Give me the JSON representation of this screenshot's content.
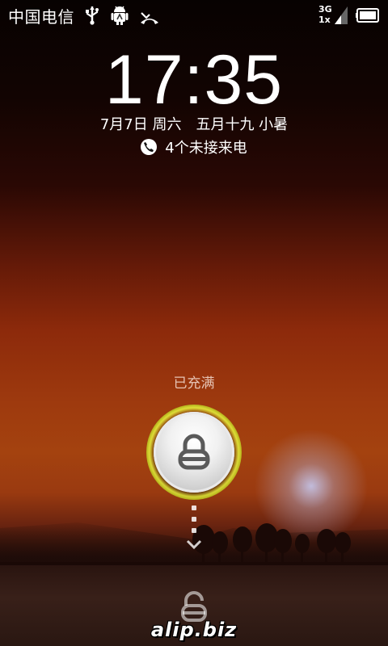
{
  "status_bar": {
    "carrier": "中国电信",
    "icons_left": [
      "usb-icon",
      "android-debug-icon",
      "missed-call-icon"
    ],
    "network_top": "3G",
    "network_bottom": "1x",
    "icons_right": [
      "signal-icon",
      "battery-full-icon"
    ]
  },
  "lockscreen": {
    "time": "17:35",
    "date": "7月7日 周六　五月十九 小暑",
    "missed_calls": "4个未接来电",
    "charge_status": "已充满"
  },
  "watermark": "alip.biz",
  "colors": {
    "accent_ring": "#c8dc1e",
    "text": "#ffffff"
  }
}
